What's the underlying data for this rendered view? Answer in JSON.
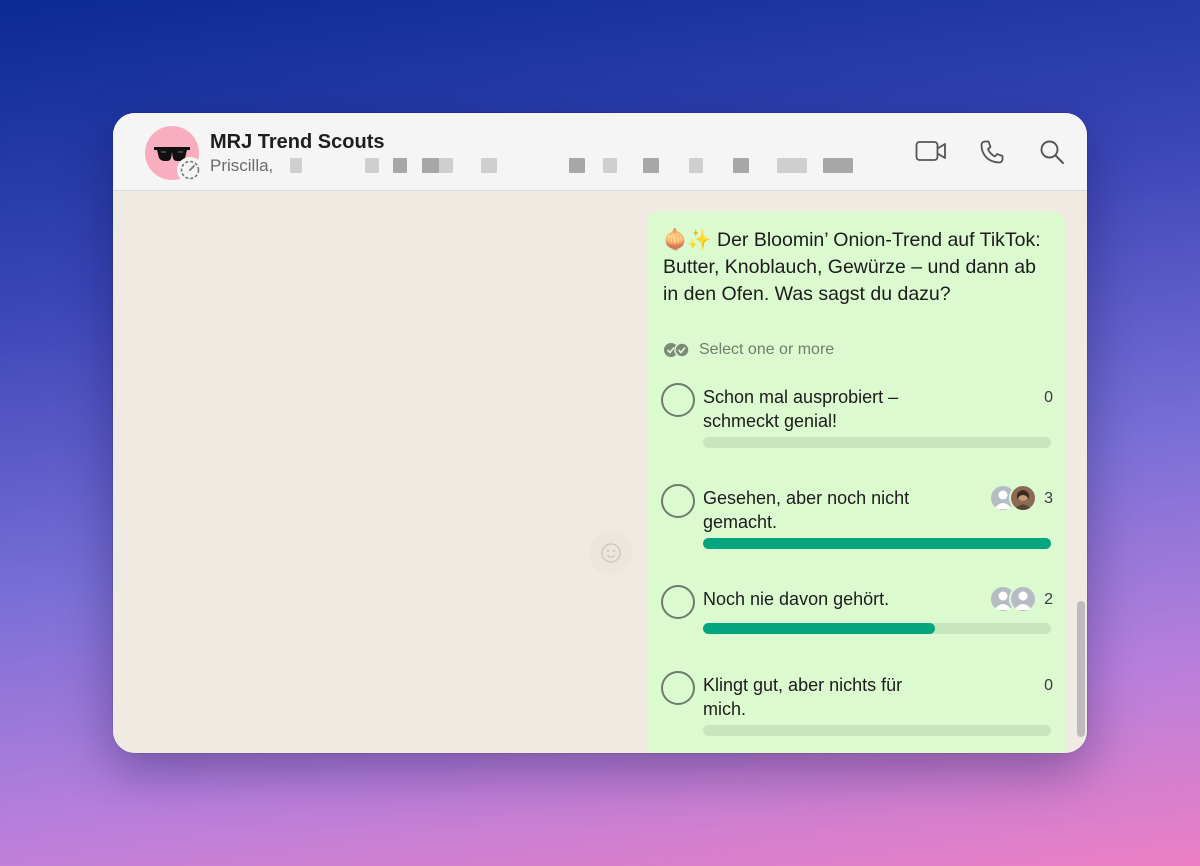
{
  "header": {
    "title": "MRJ Trend Scouts",
    "subtitle": "Priscilla,",
    "icons": [
      "video-call-icon",
      "voice-call-icon",
      "search-icon"
    ]
  },
  "poll": {
    "emoji": "🧅✨",
    "question": "Der Bloomin’ Onion-Trend auf TikTok: Butter, Knoblauch, Gewürze – und dann ab in den Ofen. Was sagst du dazu?",
    "hint": "Select one or more",
    "options": [
      {
        "label": "Schon mal ausprobiert – schmeckt genial!",
        "count": "0",
        "fraction": 0
      },
      {
        "label": "Gesehen, aber noch nicht gemacht.",
        "count": "3",
        "fraction": 1.0
      },
      {
        "label": "Noch nie davon gehört.",
        "count": "2",
        "fraction": 0.667
      },
      {
        "label": "Klingt gut, aber nichts für mich.",
        "count": "0",
        "fraction": 0
      }
    ]
  },
  "colors": {
    "bubble": "#dcfad0",
    "bar_fill": "#05a57f",
    "bar_track": "#c8e6bd",
    "chat_bg": "#efeae2",
    "avatar_bg": "#f9aec0"
  }
}
